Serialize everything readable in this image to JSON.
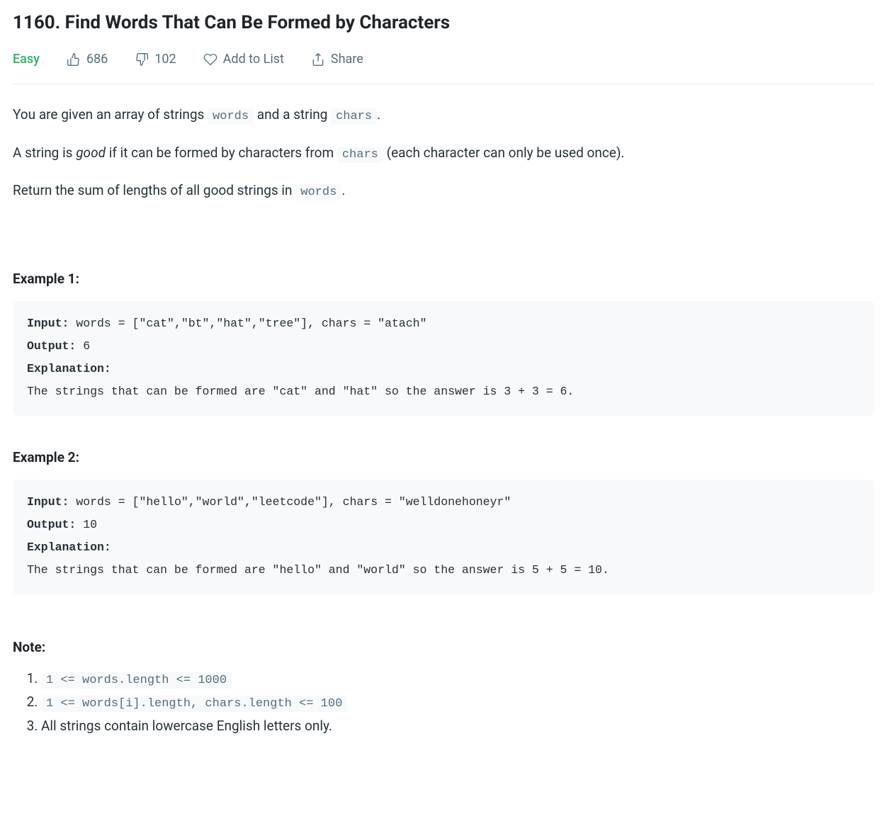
{
  "title": "1160. Find Words That Can Be Formed by Characters",
  "meta": {
    "difficulty": "Easy",
    "likes": "686",
    "dislikes": "102",
    "add_to_list": "Add to List",
    "share": "Share"
  },
  "desc": {
    "p1_a": "You are given an array of strings ",
    "p1_c1": "words",
    "p1_b": " and a string ",
    "p1_c2": "chars",
    "p1_c": ".",
    "p2_a": "A string is ",
    "p2_em": "good",
    "p2_b": " if it can be formed by characters from ",
    "p2_c1": "chars",
    "p2_c": " (each character can only be used once).",
    "p3_a": "Return the sum of lengths of all good strings in ",
    "p3_c1": "words",
    "p3_b": "."
  },
  "examples": [
    {
      "heading": "Example 1:",
      "labels": {
        "input": "Input:",
        "output": "Output:",
        "explanation": "Explanation: "
      },
      "input_text": " words = [\"cat\",\"bt\",\"hat\",\"tree\"], chars = \"atach\"",
      "output_text": " 6",
      "explanation_text": "\nThe strings that can be formed are \"cat\" and \"hat\" so the answer is 3 + 3 = 6."
    },
    {
      "heading": "Example 2:",
      "labels": {
        "input": "Input:",
        "output": "Output:",
        "explanation": "Explanation: "
      },
      "input_text": " words = [\"hello\",\"world\",\"leetcode\"], chars = \"welldonehoneyr\"",
      "output_text": " 10",
      "explanation_text": "\nThe strings that can be formed are \"hello\" and \"world\" so the answer is 5 + 5 = 10."
    }
  ],
  "note": {
    "heading": "Note:",
    "items": [
      {
        "code": "1 <= words.length <= 1000"
      },
      {
        "code": "1 <= words[i].length, chars.length <= 100"
      },
      {
        "text": "All strings contain lowercase English letters only."
      }
    ]
  }
}
